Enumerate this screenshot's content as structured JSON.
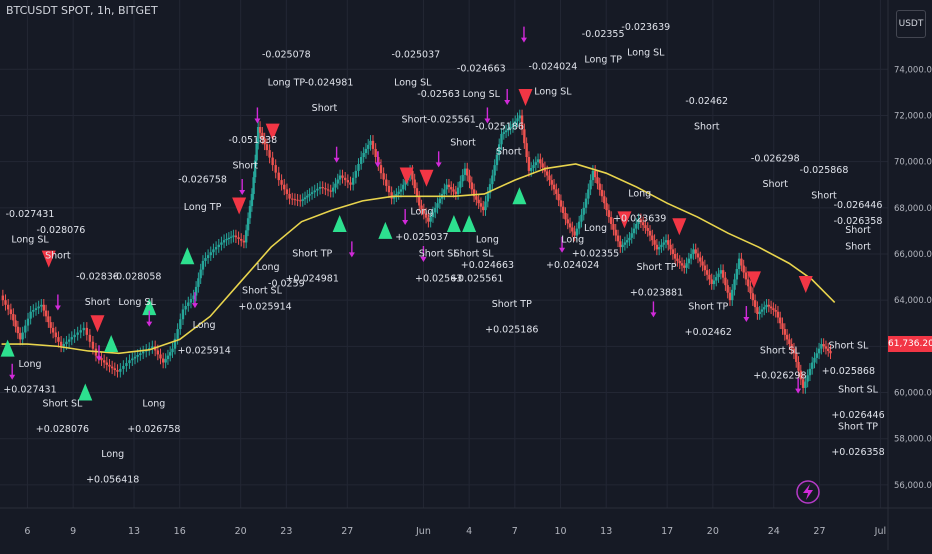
{
  "header": {
    "symbol_title": "BTCUSDT SPOT, 1h, BITGET",
    "currency_label": "USDT"
  },
  "current_price": "61,736.20",
  "colors": {
    "background": "#161a25",
    "grid": "#232734",
    "ma_line": "#e8d44d",
    "long_marker": "#2de08f",
    "short_marker": "#f23645",
    "exit_arrow": "#d12ad9",
    "entry_arrow": "#3a7bd5",
    "candle_up": "#26a69a",
    "candle_down": "#ef5350",
    "axis_text": "#b2b5be",
    "label_text": "#e0e3eb"
  },
  "chart_data": {
    "type": "candlestick",
    "ylim": [
      55000,
      77000
    ],
    "y_ticks": [
      "56,000.00",
      "58,000.00",
      "60,000.00",
      "62,000.00",
      "64,000.00",
      "66,000.00",
      "68,000.00",
      "70,000.00",
      "72,000.00",
      "74,000.00"
    ],
    "y_tick_values": [
      56000,
      58000,
      60000,
      62000,
      64000,
      66000,
      68000,
      70000,
      72000,
      74000
    ],
    "x_ticks": [
      "6",
      "9",
      "13",
      "16",
      "20",
      "23",
      "27",
      "Jun",
      "4",
      "7",
      "10",
      "13",
      "17",
      "20",
      "24",
      "27",
      "Jul"
    ],
    "x_tick_days": [
      6,
      9,
      13,
      16,
      20,
      23,
      27,
      32,
      35,
      38,
      41,
      44,
      48,
      51,
      55,
      58,
      62
    ],
    "xlim": [
      4.2,
      62.5
    ],
    "price_path": [
      [
        4.3,
        64200
      ],
      [
        5,
        63400
      ],
      [
        5.6,
        62300
      ],
      [
        6.3,
        63500
      ],
      [
        7,
        63800
      ],
      [
        7.6,
        62800
      ],
      [
        8.3,
        62000
      ],
      [
        9,
        62400
      ],
      [
        9.8,
        62800
      ],
      [
        10.6,
        61600
      ],
      [
        11.3,
        61200
      ],
      [
        12,
        60900
      ],
      [
        12.8,
        61400
      ],
      [
        13.5,
        61700
      ],
      [
        14.3,
        62000
      ],
      [
        15,
        61300
      ],
      [
        15.6,
        61900
      ],
      [
        16.3,
        63600
      ],
      [
        17,
        64200
      ],
      [
        17.6,
        65700
      ],
      [
        18.3,
        66200
      ],
      [
        19,
        66600
      ],
      [
        19.6,
        66800
      ],
      [
        20.3,
        66500
      ],
      [
        20.8,
        68600
      ],
      [
        21.2,
        71500
      ],
      [
        21.8,
        70500
      ],
      [
        22.6,
        69200
      ],
      [
        23.3,
        68400
      ],
      [
        24,
        68300
      ],
      [
        24.6,
        68600
      ],
      [
        25.3,
        68900
      ],
      [
        26,
        68700
      ],
      [
        26.6,
        69400
      ],
      [
        27.3,
        69000
      ],
      [
        28,
        70200
      ],
      [
        28.6,
        70900
      ],
      [
        29.3,
        69500
      ],
      [
        30,
        68400
      ],
      [
        30.6,
        68800
      ],
      [
        31.2,
        69600
      ],
      [
        31.8,
        68100
      ],
      [
        32.4,
        67400
      ],
      [
        33,
        68200
      ],
      [
        33.6,
        69000
      ],
      [
        34.2,
        68600
      ],
      [
        34.8,
        69700
      ],
      [
        35.4,
        68500
      ],
      [
        36,
        67900
      ],
      [
        36.6,
        69400
      ],
      [
        37.2,
        71200
      ],
      [
        37.8,
        71500
      ],
      [
        38.4,
        72000
      ],
      [
        39,
        69600
      ],
      [
        39.6,
        70100
      ],
      [
        40.2,
        69400
      ],
      [
        40.8,
        68600
      ],
      [
        41.4,
        67500
      ],
      [
        42,
        66800
      ],
      [
        42.6,
        68000
      ],
      [
        43.2,
        69600
      ],
      [
        43.8,
        68500
      ],
      [
        44.4,
        67300
      ],
      [
        45,
        66300
      ],
      [
        45.6,
        66700
      ],
      [
        46.2,
        67500
      ],
      [
        46.8,
        67000
      ],
      [
        47.4,
        66200
      ],
      [
        48,
        66600
      ],
      [
        48.6,
        65800
      ],
      [
        49.2,
        65400
      ],
      [
        49.8,
        66200
      ],
      [
        50.4,
        65500
      ],
      [
        51,
        64700
      ],
      [
        51.6,
        65300
      ],
      [
        52.2,
        64000
      ],
      [
        52.8,
        65800
      ],
      [
        53.4,
        64600
      ],
      [
        54,
        63400
      ],
      [
        54.6,
        63800
      ],
      [
        55.2,
        63500
      ],
      [
        55.8,
        62500
      ],
      [
        56.4,
        61700
      ],
      [
        57,
        60200
      ],
      [
        57.6,
        61300
      ],
      [
        58.2,
        62100
      ],
      [
        58.8,
        61700
      ]
    ],
    "ma_path": [
      [
        4.3,
        62100
      ],
      [
        6,
        62100
      ],
      [
        8,
        62000
      ],
      [
        10,
        61800
      ],
      [
        12,
        61700
      ],
      [
        14,
        61850
      ],
      [
        16,
        62300
      ],
      [
        18,
        63300
      ],
      [
        20,
        64800
      ],
      [
        22,
        66300
      ],
      [
        24,
        67400
      ],
      [
        26,
        67900
      ],
      [
        28,
        68300
      ],
      [
        30,
        68500
      ],
      [
        32,
        68500
      ],
      [
        34,
        68500
      ],
      [
        36,
        68600
      ],
      [
        38,
        69200
      ],
      [
        40,
        69700
      ],
      [
        42,
        69900
      ],
      [
        44,
        69500
      ],
      [
        46,
        68900
      ],
      [
        48,
        68200
      ],
      [
        50,
        67600
      ],
      [
        52,
        66900
      ],
      [
        54,
        66300
      ],
      [
        56,
        65600
      ],
      [
        57.5,
        64900
      ],
      [
        59,
        63900
      ]
    ],
    "long_markers": [
      [
        4.7,
        61900
      ],
      [
        9.8,
        60000
      ],
      [
        11.5,
        62100
      ],
      [
        14,
        63700
      ],
      [
        16.5,
        65900
      ],
      [
        26.5,
        67300
      ],
      [
        29.5,
        67000
      ],
      [
        34,
        67300
      ],
      [
        35,
        67300
      ],
      [
        38.3,
        68500
      ]
    ],
    "short_markers": [
      [
        7.4,
        65800
      ],
      [
        10.6,
        63000
      ],
      [
        19.9,
        68100
      ],
      [
        22.1,
        71300
      ],
      [
        30.9,
        69400
      ],
      [
        32.2,
        69300
      ],
      [
        38.7,
        72800
      ],
      [
        45.2,
        67500
      ],
      [
        48.8,
        67200
      ],
      [
        53.7,
        64900
      ],
      [
        57.1,
        64700
      ]
    ],
    "exit_arrows": [
      [
        5,
        60900
      ],
      [
        8,
        63900
      ],
      [
        10.7,
        61700
      ],
      [
        14,
        63200
      ],
      [
        17,
        64000
      ],
      [
        20.1,
        68900
      ],
      [
        21.1,
        72000
      ],
      [
        26.3,
        70300
      ],
      [
        27.3,
        66200
      ],
      [
        29,
        70100
      ],
      [
        30.8,
        67600
      ],
      [
        32,
        66000
      ],
      [
        33,
        70100
      ],
      [
        36.2,
        72000
      ],
      [
        37.5,
        72800
      ],
      [
        38.6,
        75500
      ],
      [
        41.1,
        66400
      ],
      [
        47.1,
        63600
      ],
      [
        53.2,
        63400
      ],
      [
        56.6,
        60300
      ]
    ],
    "annotations": [
      {
        "x": 5.2,
        "y": 67600,
        "text": "-0.027431"
      },
      {
        "x": 5.2,
        "y": 66500,
        "text": "Long SL"
      },
      {
        "x": 8.2,
        "y": 66900,
        "text": "-0.028076"
      },
      {
        "x": 8,
        "y": 65800,
        "text": "Short"
      },
      {
        "x": 10.6,
        "y": 64900,
        "text": "-0.02836"
      },
      {
        "x": 10.6,
        "y": 63800,
        "text": "Short"
      },
      {
        "x": 13.2,
        "y": 64900,
        "text": "-0.028058"
      },
      {
        "x": 13.2,
        "y": 63800,
        "text": "Long SL"
      },
      {
        "x": 4.8,
        "y": 61100,
        "text": "Long"
      },
      {
        "x": 4.8,
        "y": 60000,
        "text": "+0.027431"
      },
      {
        "x": 8.3,
        "y": 59400,
        "text": "Short SL"
      },
      {
        "x": 8.3,
        "y": 58300,
        "text": "+0.028076"
      },
      {
        "x": 11.6,
        "y": 57200,
        "text": "Long"
      },
      {
        "x": 11.6,
        "y": 56100,
        "text": "+0.056418"
      },
      {
        "x": 14.3,
        "y": 59400,
        "text": "Long"
      },
      {
        "x": 14.3,
        "y": 58300,
        "text": "+0.026758"
      },
      {
        "x": 17.5,
        "y": 69100,
        "text": "-0.026758"
      },
      {
        "x": 17.5,
        "y": 67900,
        "text": "Long TP"
      },
      {
        "x": 20.8,
        "y": 70800,
        "text": "-0.051838"
      },
      {
        "x": 20.3,
        "y": 69700,
        "text": "Short"
      },
      {
        "x": 23,
        "y": 74500,
        "text": "-0.025078"
      },
      {
        "x": 23,
        "y": 73300,
        "text": "Long TP"
      },
      {
        "x": 25.8,
        "y": 73300,
        "text": "-0.024981"
      },
      {
        "x": 25.5,
        "y": 72200,
        "text": "Short"
      },
      {
        "x": 17.6,
        "y": 62800,
        "text": "Long"
      },
      {
        "x": 17.6,
        "y": 61700,
        "text": "+0.025914"
      },
      {
        "x": 21.8,
        "y": 65300,
        "text": "Long"
      },
      {
        "x": 21.4,
        "y": 64300,
        "text": "Short SL"
      },
      {
        "x": 21.6,
        "y": 63600,
        "text": "+0.025914"
      },
      {
        "x": 23,
        "y": 64600,
        "text": "-0.0259"
      },
      {
        "x": 24.7,
        "y": 65900,
        "text": "Short TP"
      },
      {
        "x": 24.7,
        "y": 64800,
        "text": "+0.024981"
      },
      {
        "x": 31.5,
        "y": 74500,
        "text": "-0.025037"
      },
      {
        "x": 31.3,
        "y": 73300,
        "text": "Long SL"
      },
      {
        "x": 33,
        "y": 72800,
        "text": "-0.02563"
      },
      {
        "x": 33,
        "y": 71700,
        "text": "Short-0.025561"
      },
      {
        "x": 35.8,
        "y": 73900,
        "text": "-0.024663"
      },
      {
        "x": 35.8,
        "y": 72800,
        "text": "Long SL"
      },
      {
        "x": 34.6,
        "y": 70700,
        "text": "Short"
      },
      {
        "x": 37,
        "y": 71400,
        "text": "-0.025186"
      },
      {
        "x": 37.6,
        "y": 70300,
        "text": "Short"
      },
      {
        "x": 31.9,
        "y": 67700,
        "text": "Long"
      },
      {
        "x": 31.9,
        "y": 66600,
        "text": "+0.025037"
      },
      {
        "x": 33,
        "y": 65900,
        "text": "Short SL"
      },
      {
        "x": 33,
        "y": 64800,
        "text": "+0.02563"
      },
      {
        "x": 35.3,
        "y": 65900,
        "text": "Short SL"
      },
      {
        "x": 35.5,
        "y": 64800,
        "text": "+0.025561"
      },
      {
        "x": 36.2,
        "y": 66500,
        "text": "Long"
      },
      {
        "x": 36.2,
        "y": 65400,
        "text": "+0.024663"
      },
      {
        "x": 37.8,
        "y": 63700,
        "text": "Short TP"
      },
      {
        "x": 37.8,
        "y": 62600,
        "text": "+0.025186"
      },
      {
        "x": 40.5,
        "y": 74000,
        "text": "-0.024024"
      },
      {
        "x": 40.5,
        "y": 72900,
        "text": "Long SL"
      },
      {
        "x": 43.8,
        "y": 75400,
        "text": "-0.02355"
      },
      {
        "x": 43.8,
        "y": 74300,
        "text": "Long TP"
      },
      {
        "x": 46.6,
        "y": 75700,
        "text": "-0.023639"
      },
      {
        "x": 46.6,
        "y": 74600,
        "text": "Long SL"
      },
      {
        "x": 41.8,
        "y": 66500,
        "text": "Long"
      },
      {
        "x": 41.8,
        "y": 65400,
        "text": "+0.024024"
      },
      {
        "x": 43.3,
        "y": 67000,
        "text": "Long"
      },
      {
        "x": 43.3,
        "y": 65900,
        "text": "+0.02355"
      },
      {
        "x": 46.2,
        "y": 68500,
        "text": "Long"
      },
      {
        "x": 46.2,
        "y": 67400,
        "text": "+0.023639"
      },
      {
        "x": 47.3,
        "y": 65300,
        "text": "Short TP"
      },
      {
        "x": 47.3,
        "y": 64200,
        "text": "+0.023881"
      },
      {
        "x": 50.6,
        "y": 72500,
        "text": "-0.02462"
      },
      {
        "x": 50.6,
        "y": 71400,
        "text": "Short"
      },
      {
        "x": 50.7,
        "y": 63600,
        "text": "Short TP"
      },
      {
        "x": 50.7,
        "y": 62500,
        "text": "+0.02462"
      },
      {
        "x": 55.1,
        "y": 70000,
        "text": "-0.026298"
      },
      {
        "x": 55.1,
        "y": 68900,
        "text": "Short"
      },
      {
        "x": 58.3,
        "y": 69500,
        "text": "-0.025868"
      },
      {
        "x": 58.3,
        "y": 68400,
        "text": "Short"
      },
      {
        "x": 55.4,
        "y": 61700,
        "text": "Short SL"
      },
      {
        "x": 55.4,
        "y": 60600,
        "text": "+0.026298"
      },
      {
        "x": 59.9,
        "y": 61900,
        "text": "Short SL"
      },
      {
        "x": 59.9,
        "y": 60800,
        "text": "+0.025868"
      },
      {
        "x": 62.7,
        "y": 68000,
        "text": "-0.026446"
      },
      {
        "x": 62.7,
        "y": 66900,
        "text": "Short"
      },
      {
        "x": 66,
        "y": 67300,
        "text": "-0.026358"
      },
      {
        "x": 66,
        "y": 66200,
        "text": "Short"
      },
      {
        "x": 62.9,
        "y": 60000,
        "text": "Short SL"
      },
      {
        "x": 62.9,
        "y": 58900,
        "text": "+0.026446"
      },
      {
        "x": 66.1,
        "y": 58400,
        "text": "Short TP"
      },
      {
        "x": 66.1,
        "y": 57300,
        "text": "+0.026358"
      }
    ]
  },
  "footer": {
    "replay_icon": "lightning-icon"
  }
}
